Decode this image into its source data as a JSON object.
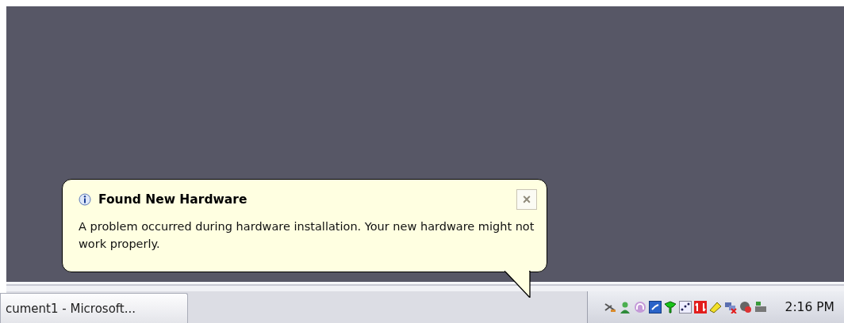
{
  "balloon": {
    "title": "Found New Hardware",
    "message": "A problem occurred during hardware installation. Your new hardware might not work properly.",
    "close": "×"
  },
  "taskbar": {
    "buttons": [
      {
        "label": "cument1 - Microsoft...",
        "selected": false
      }
    ],
    "clock": "2:16 PM"
  }
}
